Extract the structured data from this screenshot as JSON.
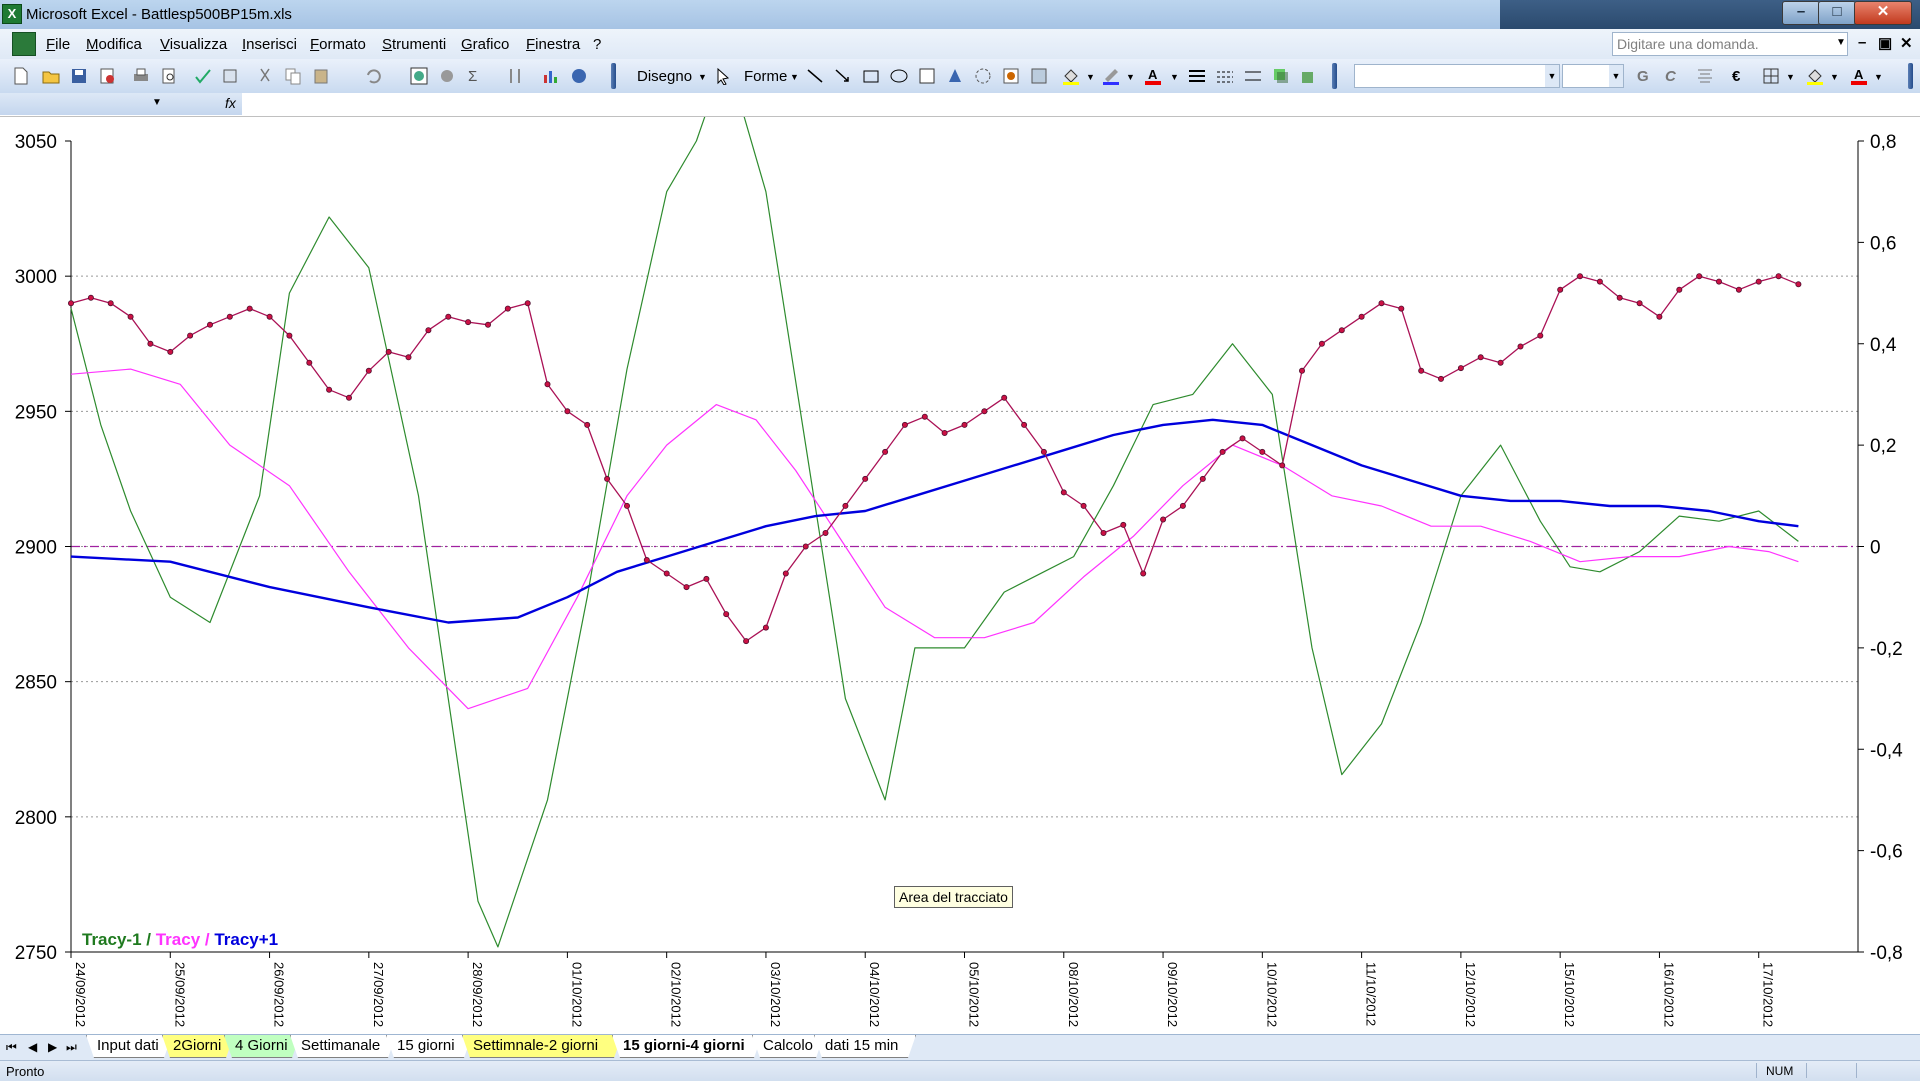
{
  "window": {
    "title": "Microsoft Excel - Battlesp500BP15m.xls",
    "icon": "excel-icon"
  },
  "menu": {
    "items": [
      "File",
      "Modifica",
      "Visualizza",
      "Inserisci",
      "Formato",
      "Strumenti",
      "Grafico",
      "Finestra",
      "?"
    ],
    "ask_placeholder": "Digitare una domanda."
  },
  "toolbar": {
    "disegno_label": "Disegno",
    "forme_label": "Forme",
    "bold_label": "G",
    "italic_label": "C"
  },
  "tooltip": "Area del tracciato",
  "legend": {
    "tracy_m1": "Tracy-1",
    "sep1": " / ",
    "tracy": "Tracy",
    "sep2": " / ",
    "tracy_p1": "Tracy+1"
  },
  "sheet_tabs": [
    {
      "label": "Input dati",
      "color": "#ffffff",
      "active": false
    },
    {
      "label": "2Giorni",
      "color": "#ffff80",
      "active": false
    },
    {
      "label": "4 Giorni",
      "color": "#c0ffc0",
      "active": false
    },
    {
      "label": "Settimanale",
      "color": "#ffffff",
      "active": false
    },
    {
      "label": "15 giorni",
      "color": "#ffffff",
      "active": false
    },
    {
      "label": "Settimnale-2 giorni",
      "color": "#ffff80",
      "active": false
    },
    {
      "label": "15 giorni-4 giorni",
      "color": "#ffffff",
      "active": true
    },
    {
      "label": "Calcolo",
      "color": "#ffffff",
      "active": false
    },
    {
      "label": "dati 15 min",
      "color": "#ffffff",
      "active": false
    }
  ],
  "status": {
    "left": "Pronto",
    "num": "NUM"
  },
  "chart_data": {
    "type": "line",
    "ylim_left": [
      2750,
      3050
    ],
    "yticks_left": [
      "3050",
      "3000",
      "2950",
      "2900",
      "2850",
      "2800",
      "2750"
    ],
    "ylim_right": [
      -0.8,
      0.8
    ],
    "yticks_right": [
      "0,8",
      "0,6",
      "0,4",
      "0,2",
      "0",
      "-0,2",
      "-0,4",
      "-0,6",
      "-0,8"
    ],
    "x_categories": [
      "24/09/2012",
      "25/09/2012",
      "26/09/2012",
      "27/09/2012",
      "28/09/2012",
      "01/10/2012",
      "02/10/2012",
      "03/10/2012",
      "04/10/2012",
      "05/10/2012",
      "08/10/2012",
      "09/10/2012",
      "10/10/2012",
      "11/10/2012",
      "12/10/2012",
      "15/10/2012",
      "16/10/2012",
      "17/10/2012"
    ],
    "grid": "horizontal dotted",
    "zero_line": "dash-dot, right axis",
    "series": [
      {
        "name": "Tracy-1",
        "axis": "right",
        "color": "#2e8b2e",
        "points": [
          [
            0,
            0.47
          ],
          [
            0.3,
            0.24
          ],
          [
            0.6,
            0.07
          ],
          [
            1.0,
            -0.1
          ],
          [
            1.4,
            -0.15
          ],
          [
            1.9,
            0.1
          ],
          [
            2.2,
            0.5
          ],
          [
            2.6,
            0.65
          ],
          [
            3.0,
            0.55
          ],
          [
            3.5,
            0.1
          ],
          [
            4.1,
            -0.7
          ],
          [
            4.3,
            -0.79
          ],
          [
            4.8,
            -0.5
          ],
          [
            5.2,
            -0.1
          ],
          [
            5.6,
            0.35
          ],
          [
            6.0,
            0.7
          ],
          [
            6.3,
            0.8
          ],
          [
            6.6,
            0.97
          ],
          [
            7.0,
            0.7
          ],
          [
            7.4,
            0.2
          ],
          [
            7.8,
            -0.3
          ],
          [
            8.2,
            -0.5
          ],
          [
            8.5,
            -0.2
          ],
          [
            9.0,
            -0.2
          ],
          [
            9.4,
            -0.09
          ],
          [
            9.8,
            -0.05
          ],
          [
            10.1,
            -0.02
          ],
          [
            10.5,
            0.12
          ],
          [
            10.9,
            0.28
          ],
          [
            11.3,
            0.3
          ],
          [
            11.7,
            0.4
          ],
          [
            12.1,
            0.3
          ],
          [
            12.5,
            -0.2
          ],
          [
            12.8,
            -0.45
          ],
          [
            13.2,
            -0.35
          ],
          [
            13.6,
            -0.15
          ],
          [
            14.0,
            0.1
          ],
          [
            14.4,
            0.2
          ],
          [
            14.8,
            0.05
          ],
          [
            15.1,
            -0.04
          ],
          [
            15.4,
            -0.05
          ],
          [
            15.8,
            -0.01
          ],
          [
            16.2,
            0.06
          ],
          [
            16.6,
            0.05
          ],
          [
            17.0,
            0.07
          ],
          [
            17.4,
            0.01
          ]
        ]
      },
      {
        "name": "Tracy",
        "axis": "right",
        "color": "#ff33ff",
        "points": [
          [
            0,
            0.34
          ],
          [
            0.6,
            0.35
          ],
          [
            1.1,
            0.32
          ],
          [
            1.6,
            0.2
          ],
          [
            2.2,
            0.12
          ],
          [
            2.8,
            -0.05
          ],
          [
            3.4,
            -0.2
          ],
          [
            4.0,
            -0.32
          ],
          [
            4.6,
            -0.28
          ],
          [
            5.1,
            -0.1
          ],
          [
            5.6,
            0.1
          ],
          [
            6.0,
            0.2
          ],
          [
            6.5,
            0.28
          ],
          [
            6.9,
            0.25
          ],
          [
            7.3,
            0.15
          ],
          [
            7.8,
            0.0
          ],
          [
            8.2,
            -0.12
          ],
          [
            8.7,
            -0.18
          ],
          [
            9.2,
            -0.18
          ],
          [
            9.7,
            -0.15
          ],
          [
            10.2,
            -0.06
          ],
          [
            10.7,
            0.02
          ],
          [
            11.2,
            0.12
          ],
          [
            11.7,
            0.2
          ],
          [
            12.2,
            0.16
          ],
          [
            12.7,
            0.1
          ],
          [
            13.2,
            0.08
          ],
          [
            13.7,
            0.04
          ],
          [
            14.2,
            0.04
          ],
          [
            14.7,
            0.01
          ],
          [
            15.2,
            -0.03
          ],
          [
            15.7,
            -0.02
          ],
          [
            16.2,
            -0.02
          ],
          [
            16.7,
            0.0
          ],
          [
            17.1,
            -0.01
          ],
          [
            17.4,
            -0.03
          ]
        ]
      },
      {
        "name": "Tracy+1",
        "axis": "right",
        "color": "#0000dd",
        "points": [
          [
            0,
            -0.02
          ],
          [
            1.0,
            -0.03
          ],
          [
            2.0,
            -0.08
          ],
          [
            3.0,
            -0.12
          ],
          [
            3.8,
            -0.15
          ],
          [
            4.5,
            -0.14
          ],
          [
            5.0,
            -0.1
          ],
          [
            5.5,
            -0.05
          ],
          [
            6.0,
            -0.02
          ],
          [
            6.5,
            0.01
          ],
          [
            7.0,
            0.04
          ],
          [
            7.5,
            0.06
          ],
          [
            8.0,
            0.07
          ],
          [
            8.5,
            0.1
          ],
          [
            9.0,
            0.13
          ],
          [
            9.5,
            0.16
          ],
          [
            10.0,
            0.19
          ],
          [
            10.5,
            0.22
          ],
          [
            11.0,
            0.24
          ],
          [
            11.5,
            0.25
          ],
          [
            12.0,
            0.24
          ],
          [
            12.5,
            0.2
          ],
          [
            13.0,
            0.16
          ],
          [
            13.5,
            0.13
          ],
          [
            14.0,
            0.1
          ],
          [
            14.5,
            0.09
          ],
          [
            15.0,
            0.09
          ],
          [
            15.5,
            0.08
          ],
          [
            16.0,
            0.08
          ],
          [
            16.5,
            0.07
          ],
          [
            17.0,
            0.05
          ],
          [
            17.4,
            0.04
          ]
        ]
      },
      {
        "name": "",
        "axis": "left",
        "color": "#aa1155",
        "points": [
          [
            0,
            2990
          ],
          [
            0.2,
            2992
          ],
          [
            0.4,
            2990
          ],
          [
            0.6,
            2985
          ],
          [
            0.8,
            2975
          ],
          [
            1.0,
            2972
          ],
          [
            1.2,
            2978
          ],
          [
            1.4,
            2982
          ],
          [
            1.6,
            2985
          ],
          [
            1.8,
            2988
          ],
          [
            2.0,
            2985
          ],
          [
            2.2,
            2978
          ],
          [
            2.4,
            2968
          ],
          [
            2.6,
            2958
          ],
          [
            2.8,
            2955
          ],
          [
            3.0,
            2965
          ],
          [
            3.2,
            2972
          ],
          [
            3.4,
            2970
          ],
          [
            3.6,
            2980
          ],
          [
            3.8,
            2985
          ],
          [
            4.0,
            2983
          ],
          [
            4.2,
            2982
          ],
          [
            4.4,
            2988
          ],
          [
            4.6,
            2990
          ],
          [
            4.8,
            2960
          ],
          [
            5.0,
            2950
          ],
          [
            5.2,
            2945
          ],
          [
            5.4,
            2925
          ],
          [
            5.6,
            2915
          ],
          [
            5.8,
            2895
          ],
          [
            6.0,
            2890
          ],
          [
            6.2,
            2885
          ],
          [
            6.4,
            2888
          ],
          [
            6.6,
            2875
          ],
          [
            6.8,
            2865
          ],
          [
            7.0,
            2870
          ],
          [
            7.2,
            2890
          ],
          [
            7.4,
            2900
          ],
          [
            7.6,
            2905
          ],
          [
            7.8,
            2915
          ],
          [
            8.0,
            2925
          ],
          [
            8.2,
            2935
          ],
          [
            8.4,
            2945
          ],
          [
            8.6,
            2948
          ],
          [
            8.8,
            2942
          ],
          [
            9.0,
            2945
          ],
          [
            9.2,
            2950
          ],
          [
            9.4,
            2955
          ],
          [
            9.6,
            2945
          ],
          [
            9.8,
            2935
          ],
          [
            10.0,
            2920
          ],
          [
            10.2,
            2915
          ],
          [
            10.4,
            2905
          ],
          [
            10.6,
            2908
          ],
          [
            10.8,
            2890
          ],
          [
            11.0,
            2910
          ],
          [
            11.2,
            2915
          ],
          [
            11.4,
            2925
          ],
          [
            11.6,
            2935
          ],
          [
            11.8,
            2940
          ],
          [
            12.0,
            2935
          ],
          [
            12.2,
            2930
          ],
          [
            12.4,
            2965
          ],
          [
            12.6,
            2975
          ],
          [
            12.8,
            2980
          ],
          [
            13.0,
            2985
          ],
          [
            13.2,
            2990
          ],
          [
            13.4,
            2988
          ],
          [
            13.6,
            2965
          ],
          [
            13.8,
            2962
          ],
          [
            14.0,
            2966
          ],
          [
            14.2,
            2970
          ],
          [
            14.4,
            2968
          ],
          [
            14.6,
            2974
          ],
          [
            14.8,
            2978
          ],
          [
            15.0,
            2995
          ],
          [
            15.2,
            3000
          ],
          [
            15.4,
            2998
          ],
          [
            15.6,
            2992
          ],
          [
            15.8,
            2990
          ],
          [
            16.0,
            2985
          ],
          [
            16.2,
            2995
          ],
          [
            16.4,
            3000
          ],
          [
            16.6,
            2998
          ],
          [
            16.8,
            2995
          ],
          [
            17.0,
            2998
          ],
          [
            17.2,
            3000
          ],
          [
            17.4,
            2997
          ]
        ]
      }
    ]
  }
}
